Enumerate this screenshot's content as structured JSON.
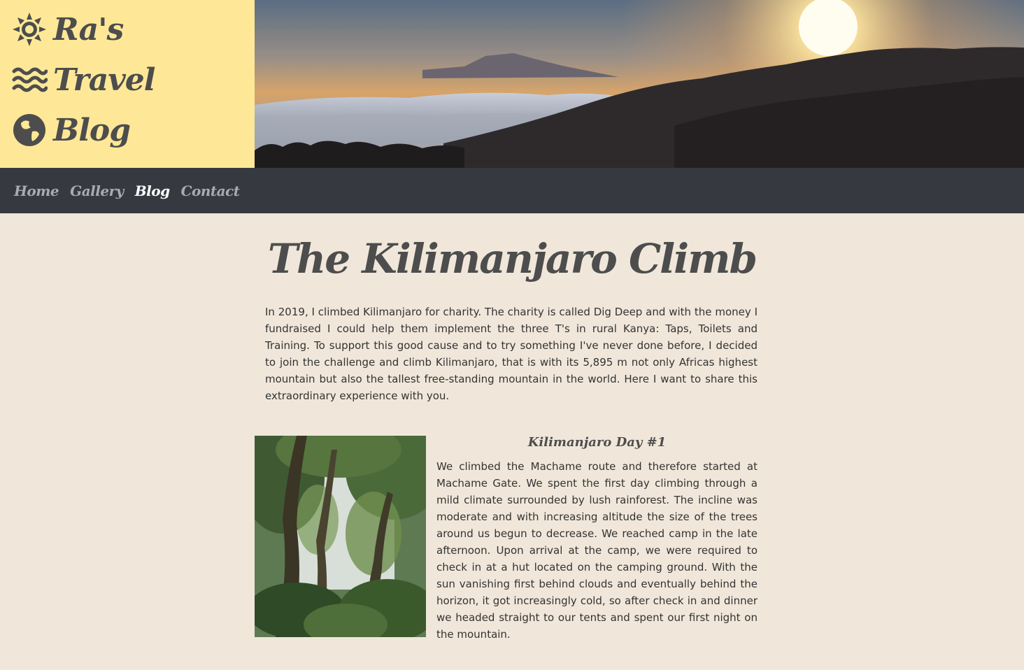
{
  "logo": {
    "line1": "Ra's",
    "line2": "Travel",
    "line3": "Blog",
    "icons": [
      "sun-icon",
      "waves-icon",
      "globe-icon"
    ]
  },
  "nav": {
    "items": [
      {
        "label": "Home",
        "active": false
      },
      {
        "label": "Gallery",
        "active": false
      },
      {
        "label": "Blog",
        "active": true
      },
      {
        "label": "Contact",
        "active": false
      }
    ]
  },
  "main": {
    "title": "The Kilimanjaro Climb",
    "intro": "In 2019, I climbed Kilimanjaro for charity. The charity is called Dig Deep and with the money I fundraised I could help them implement the three T's in rural Kanya: Taps, Toilets and Training. To support this good cause and to try something I've never done before, I decided to join the challenge and climb Kilimanjaro, that is with its 5,895 m not only Africas highest mountain but also the tallest free-standing mountain in the world. Here I want to share this extraordinary experience with you.",
    "day1": {
      "title": "Kilimanjaro Day #1",
      "text": "We climbed the Machame route and therefore started at Machame Gate. We spent the first day climbing through a mild climate surrounded by lush rainforest. The incline was moderate and with increasing altitude the size of the trees around us begun to decrease. We reached camp in the late afternoon. Upon arrival at the camp, we were required to check in at a hut located on the camping ground. With the sun vanishing first behind clouds and eventually behind the horizon, it got increasingly cold, so after check in and dinner we headed straight to our tents and spent our first night on the mountain."
    }
  },
  "colors": {
    "logo_bg": "#fee897",
    "nav_bg": "#363a40",
    "page_bg": "#f0e7da",
    "heading": "#4d4d4d",
    "nav_inactive": "#a9abae",
    "nav_active": "#ffffff"
  }
}
